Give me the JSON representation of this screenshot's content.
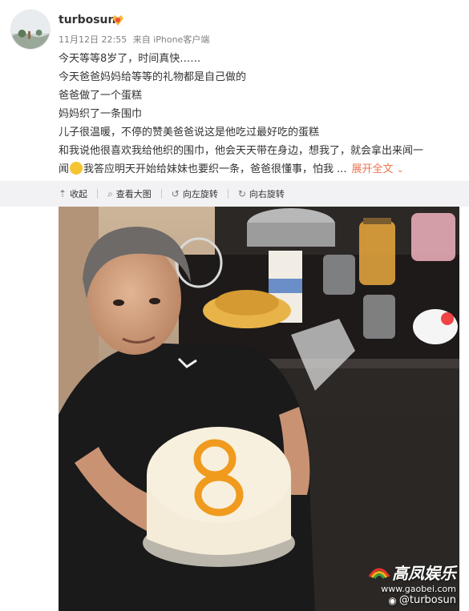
{
  "user": {
    "name": "turbosun",
    "vip_icon": "vip-badge-icon"
  },
  "meta": {
    "date": "11月12日 22:55",
    "source": "来自 iPhone客户端"
  },
  "content": {
    "line1": "今天等等8岁了，时间真快……",
    "line2": "今天爸爸妈妈给等等的礼物都是自己做的",
    "line3": "爸爸做了一个蛋糕",
    "line4": "妈妈织了一条围巾",
    "line5": "儿子很温暖，不停的赞美爸爸说这是他吃过最好吃的蛋糕",
    "line6": "和我说他很喜欢我给他织的围巾，他会天天带在身边，想我了，就会拿出来闻一",
    "line7_a": "闻",
    "line7_b": "我答应明天开始给妹妹也要织一条，爸爸很懂事，怕我 ...",
    "expand_label": "展开全文"
  },
  "actions": {
    "collapse": "收起",
    "view_large": "查看大图",
    "rotate_left": "向左旋转",
    "rotate_right": "向右旋转"
  },
  "watermark": {
    "brand": "高凤娱乐",
    "url": "www.gaobei.com",
    "handle": "@turbosun"
  },
  "colors": {
    "accent_link": "#eb7350",
    "actionbar_bg": "#f2f2f5",
    "meta_gray": "#808080"
  }
}
